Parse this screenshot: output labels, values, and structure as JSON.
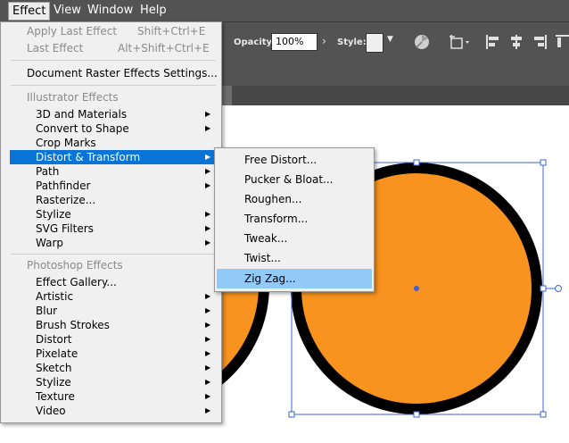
{
  "menubar": {
    "items": [
      {
        "label": "Effect",
        "active": true
      },
      {
        "label": "View"
      },
      {
        "label": "Window"
      },
      {
        "label": "Help"
      }
    ]
  },
  "control_bar": {
    "opacity_label": "Opacity:",
    "opacity_value": "100%",
    "style_label": "Style:"
  },
  "effect_menu": {
    "apply_last": {
      "label": "Apply Last Effect",
      "shortcut": "Shift+Ctrl+E"
    },
    "last_effect": {
      "label": "Last Effect",
      "shortcut": "Alt+Shift+Ctrl+E"
    },
    "doc_raster": "Document Raster Effects Settings...",
    "illustrator_header": "Illustrator Effects",
    "illustrator_items": [
      {
        "label": "3D and Materials",
        "submenu": true
      },
      {
        "label": "Convert to Shape",
        "submenu": true
      },
      {
        "label": "Crop Marks",
        "submenu": false
      },
      {
        "label": "Distort & Transform",
        "submenu": true,
        "highlighted": true
      },
      {
        "label": "Path",
        "submenu": true
      },
      {
        "label": "Pathfinder",
        "submenu": true
      },
      {
        "label": "Rasterize...",
        "submenu": false
      },
      {
        "label": "Stylize",
        "submenu": true
      },
      {
        "label": "SVG Filters",
        "submenu": true
      },
      {
        "label": "Warp",
        "submenu": true
      }
    ],
    "photoshop_header": "Photoshop Effects",
    "photoshop_items": [
      {
        "label": "Effect Gallery...",
        "submenu": false
      },
      {
        "label": "Artistic",
        "submenu": true
      },
      {
        "label": "Blur",
        "submenu": true
      },
      {
        "label": "Brush Strokes",
        "submenu": true
      },
      {
        "label": "Distort",
        "submenu": true
      },
      {
        "label": "Pixelate",
        "submenu": true
      },
      {
        "label": "Sketch",
        "submenu": true
      },
      {
        "label": "Stylize",
        "submenu": true
      },
      {
        "label": "Texture",
        "submenu": true
      },
      {
        "label": "Video",
        "submenu": true
      }
    ]
  },
  "distort_submenu": {
    "items": [
      {
        "label": "Free Distort..."
      },
      {
        "label": "Pucker & Bloat..."
      },
      {
        "label": "Roughen..."
      },
      {
        "label": "Transform..."
      },
      {
        "label": "Tweak..."
      },
      {
        "label": "Twist..."
      },
      {
        "label": "Zig Zag...",
        "highlighted": true
      }
    ]
  },
  "colors": {
    "circle_fill": "#f7931e",
    "circle_stroke": "#000000",
    "selection": "#3b63d8",
    "menu_highlight": "#0a74d6",
    "submenu_highlight": "#91c9f7",
    "toolbar_bg": "#535353"
  }
}
